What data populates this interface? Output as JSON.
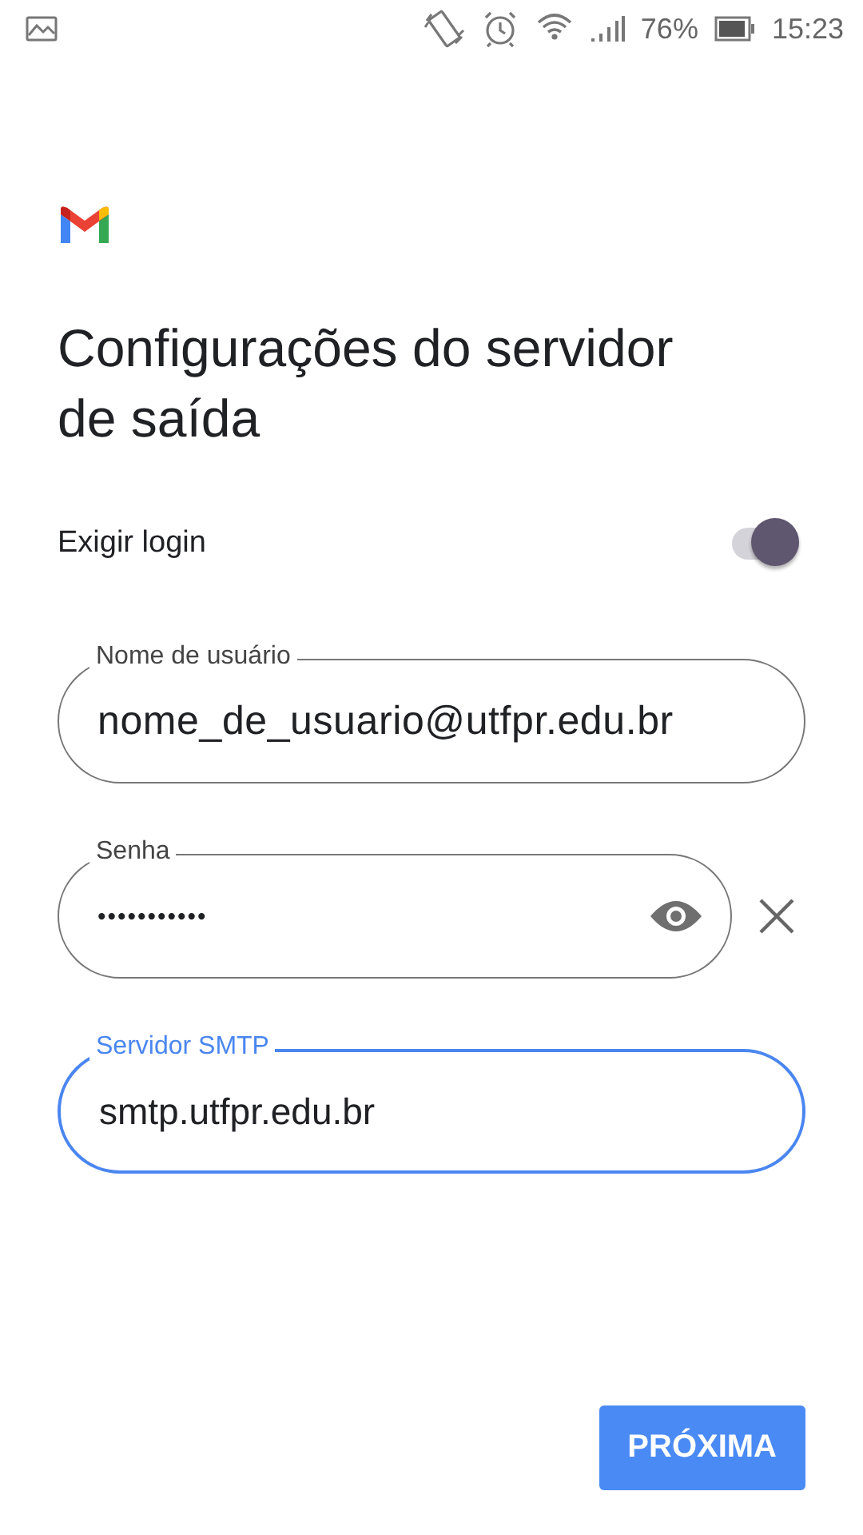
{
  "status_bar": {
    "battery": "76%",
    "time": "15:23"
  },
  "title": "Configurações do servidor de saída",
  "require_login": {
    "label": "Exigir login",
    "on": true
  },
  "fields": [
    {
      "kind": "text",
      "label": "Nome de usuário",
      "value": "nome_de_usuario@utfpr.edu.br",
      "focused": false
    },
    {
      "kind": "password",
      "label": "Senha",
      "value": "•••••••••••",
      "focused": false
    },
    {
      "kind": "text",
      "label": "Servidor SMTP",
      "value": "smtp.utfpr.edu.br",
      "focused": true
    }
  ],
  "next_button": "PRÓXIMA"
}
